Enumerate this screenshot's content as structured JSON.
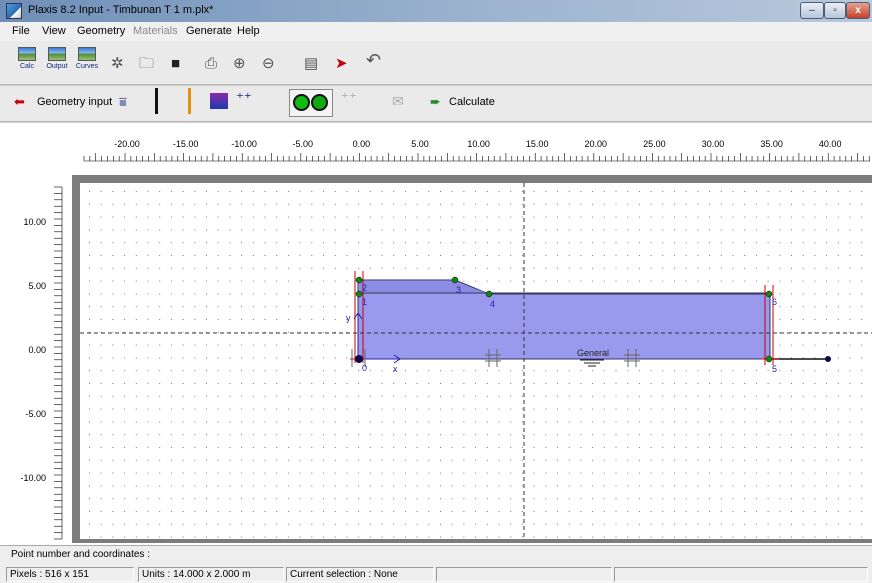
{
  "window": {
    "title": "Plaxis 8.2 Input - Timbunan T 1 m.plx*",
    "min_glyph": "–",
    "max_glyph": "▫",
    "close_glyph": "x"
  },
  "menu": {
    "items": [
      "File",
      "View",
      "Geometry",
      "Materials",
      "Generate",
      "Help"
    ]
  },
  "toolbar": {
    "calc_label": "Calc",
    "output_label": "Output",
    "curves_label": "Curves"
  },
  "navbar": {
    "geometry_input_label": "Geometry input",
    "calculate_label": "Calculate"
  },
  "ruler": {
    "h_ticks": [
      "-20.00",
      "-15.00",
      "-10.00",
      "-5.00",
      "0.00",
      "5.00",
      "10.00",
      "15.00",
      "20.00",
      "25.00",
      "30.00",
      "35.00",
      "40.00"
    ],
    "v_ticks": [
      "10.00",
      "5.00",
      "0.00",
      "-5.00",
      "-10.00"
    ]
  },
  "drawing": {
    "point_labels": [
      "0",
      "1",
      "2",
      "3",
      "4",
      "5",
      "6"
    ],
    "axis_x": "x",
    "axis_y": "y",
    "cluster_label": "General",
    "fill_color": "#9999ee",
    "stroke_color": "#000000"
  },
  "status": {
    "title": "Point number and coordinates :",
    "pixels": "Pixels : 516 x 151",
    "units": "Units  : 14.000 x 2.000 m",
    "selection": "Current selection : None"
  }
}
